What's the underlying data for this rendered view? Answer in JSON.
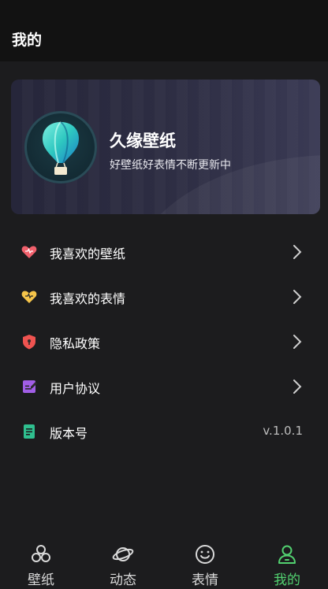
{
  "header": {
    "title": "我的"
  },
  "profile_card": {
    "app_name": "久缘壁纸",
    "slogan": "好壁纸好表情不断更新中",
    "logo_icon": "hot-air-balloon-icon"
  },
  "menu": [
    {
      "label": "我喜欢的壁纸",
      "icon": "heart-icon",
      "icon_color": "#f0606c"
    },
    {
      "label": "我喜欢的表情",
      "icon": "heart-icon",
      "icon_color": "#f6c54a"
    },
    {
      "label": "隐私政策",
      "icon": "shield-lock-icon",
      "icon_color": "#ef5350"
    },
    {
      "label": "用户协议",
      "icon": "edit-note-icon",
      "icon_color": "#a15ee6"
    },
    {
      "label": "版本号",
      "icon": "document-icon",
      "icon_color": "#2fbf8f",
      "value": "v.1.0.1"
    }
  ],
  "tabbar": {
    "active_index": 3,
    "active_color": "#52d170",
    "tabs": [
      {
        "label": "壁纸",
        "icon": "clover-icon"
      },
      {
        "label": "动态",
        "icon": "planet-icon"
      },
      {
        "label": "表情",
        "icon": "smiley-icon"
      },
      {
        "label": "我的",
        "icon": "user-icon"
      }
    ]
  }
}
